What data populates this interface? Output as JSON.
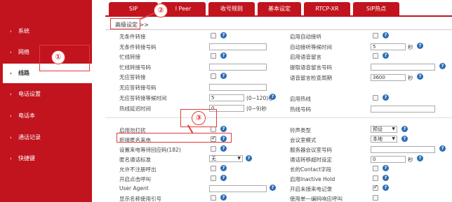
{
  "sidebar": {
    "items": [
      {
        "label": "系统"
      },
      {
        "label": "网络"
      },
      {
        "label": "线路"
      },
      {
        "label": "电话设置"
      },
      {
        "label": "电话本"
      },
      {
        "label": "通话记录"
      },
      {
        "label": "快捷键"
      }
    ],
    "active_index": 2
  },
  "tabs": [
    {
      "label": "SIP"
    },
    {
      "label": "l Peer"
    },
    {
      "label": "收号规则"
    },
    {
      "label": "基本设定"
    },
    {
      "label": "RTCP-XR"
    },
    {
      "label": "SIP热点"
    }
  ],
  "breadcrumb": "高级设定 >>",
  "annotations": {
    "one": "①",
    "two": "②",
    "three": "③"
  },
  "left_fields": {
    "r1": {
      "label": "无条件转接"
    },
    "r2": {
      "label": "无条件转接号码",
      "value": ""
    },
    "r3": {
      "label": "忙线转接"
    },
    "r4": {
      "label": "忙线转接号码",
      "value": ""
    },
    "r5": {
      "label": "无应答转接"
    },
    "r6": {
      "label": "无应答转接号码",
      "value": ""
    },
    "r7": {
      "label": "无应答转接等候时间",
      "value": "5",
      "unit": "(0~120)秒"
    },
    "r8": {
      "label": "热线延迟时间",
      "value": "0",
      "unit": "(0~9)秒"
    },
    "r9": {
      "label": "启用勿打扰"
    },
    "r10": {
      "label": "拒接匿名来电"
    },
    "r11": {
      "label": "设置来电等待回应码(182)"
    },
    "r12": {
      "label": "匿名通话标准",
      "value": "无"
    },
    "r13": {
      "label": "允许不注册呼出"
    },
    "r14": {
      "label": "开启点击呼叫"
    },
    "r15": {
      "label": "User Agent",
      "value": ""
    },
    "r16": {
      "label": "显示名称使用引号"
    }
  },
  "right_fields": {
    "r1": {
      "label": "启用自动接听"
    },
    "r2": {
      "label": "自动接听等候时间",
      "value": "5",
      "unit": "秒"
    },
    "r3": {
      "label": "启用语音留言"
    },
    "r4": {
      "label": "提取语音留言号码",
      "value": ""
    },
    "r5": {
      "label": "语音留言检查周期",
      "value": "3600",
      "unit": "秒"
    },
    "r7": {
      "label": "启用热线"
    },
    "r8": {
      "label": "热线号码",
      "value": ""
    },
    "r9": {
      "label": "铃声类型",
      "value": "预设"
    },
    "r10": {
      "label": "会议室模式",
      "value": "本地"
    },
    "r11": {
      "label": "服务器会议室号码",
      "value": ""
    },
    "r12": {
      "label": "通话转移超时设定",
      "value": "0",
      "unit": "秒"
    },
    "r13": {
      "label": "长的Contact字段"
    },
    "r14": {
      "label": "启用Inactive Hold"
    },
    "r15": {
      "label": "开启未接来电记录"
    },
    "r16": {
      "label": "使用单一编码响应呼叫"
    }
  },
  "help_glyph": "?",
  "select_arrow": "▼",
  "chevron": "›",
  "colors": {
    "brand_red": "#c1141e",
    "help_blue": "#2d6db5",
    "annotation_red": "#e23b3b"
  }
}
